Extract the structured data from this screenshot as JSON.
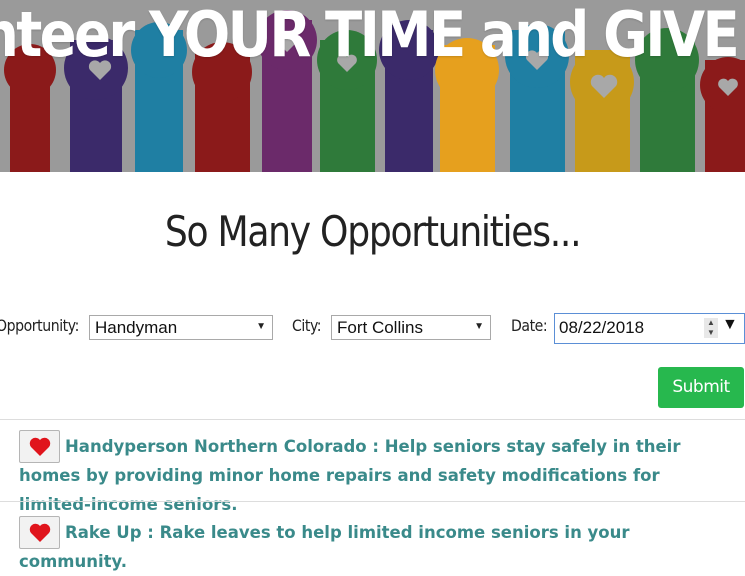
{
  "banner": {
    "text": "nteer YOUR TIME and GIVE B"
  },
  "heading": "So Many Opportunities...",
  "filters": {
    "opportunity_label": "Opportunity:",
    "opportunity_value": "Handyman",
    "city_label": "City:",
    "city_value": "Fort Collins",
    "date_label": "Date:",
    "date_value": "08/22/2018"
  },
  "submit_label": "Submit",
  "listings": [
    {
      "title": "Handyperson Northern Colorado : Help seniors stay safely in their homes by providing minor home repairs and safety modifications for limited-income seniors."
    },
    {
      "title": "Rake Up : Rake leaves to help limited income seniors in your community."
    }
  ],
  "colors": {
    "submit": "#27b84e",
    "listing_text": "#3a8a8a",
    "heart": "#e0141c"
  },
  "icons": {
    "favorite": "heart-icon",
    "dropdown": "chevron-down-icon",
    "date_stepper": "spinner-icon"
  }
}
